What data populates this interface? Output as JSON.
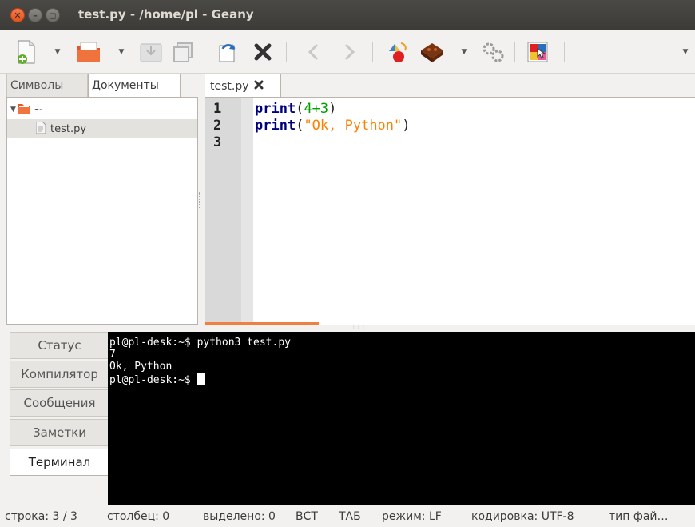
{
  "window": {
    "title": "test.py - /home/pl - Geany"
  },
  "toolbar": {
    "icons": [
      "new-file-icon",
      "open-file-icon",
      "save-icon",
      "save-all-icon",
      "reload-icon",
      "close-file-icon",
      "back-icon",
      "forward-icon",
      "compile-icon",
      "build-icon",
      "execute-icon",
      "color-chooser-icon"
    ]
  },
  "sidebar": {
    "tabs": [
      {
        "label": "Символы",
        "active": false
      },
      {
        "label": "Документы",
        "active": true
      }
    ],
    "tree": {
      "root": "~",
      "files": [
        "test.py"
      ]
    }
  },
  "editor": {
    "tab_label": "test.py",
    "lines": [
      {
        "num": "1"
      },
      {
        "num": "2"
      },
      {
        "num": "3"
      }
    ],
    "code": {
      "line1_kw": "print",
      "line1_open": "(",
      "line1_num": "4+3",
      "line1_close": ")",
      "line2_kw": "print",
      "line2_open": "(",
      "line2_str": "\"Ok, Python\"",
      "line2_close": ")"
    }
  },
  "bottom_panel": {
    "tabs": [
      {
        "label": "Статус",
        "active": false
      },
      {
        "label": "Компилятор",
        "active": false
      },
      {
        "label": "Сообщения",
        "active": false
      },
      {
        "label": "Заметки",
        "active": false
      },
      {
        "label": "Терминал",
        "active": true
      }
    ],
    "terminal": {
      "lines": [
        "pl@pl-desk:~$ python3 test.py",
        "7",
        "Ok, Python"
      ],
      "prompt": "pl@pl-desk:~$ "
    }
  },
  "statusbar": {
    "line": "строка: 3 / 3",
    "column": "столбец: 0",
    "selected": "выделено: 0",
    "insert_mode": "ВСТ",
    "indent": "ТАБ",
    "eol": "режим: LF",
    "encoding": "кодировка: UTF-8",
    "filetype": "тип фай…"
  }
}
